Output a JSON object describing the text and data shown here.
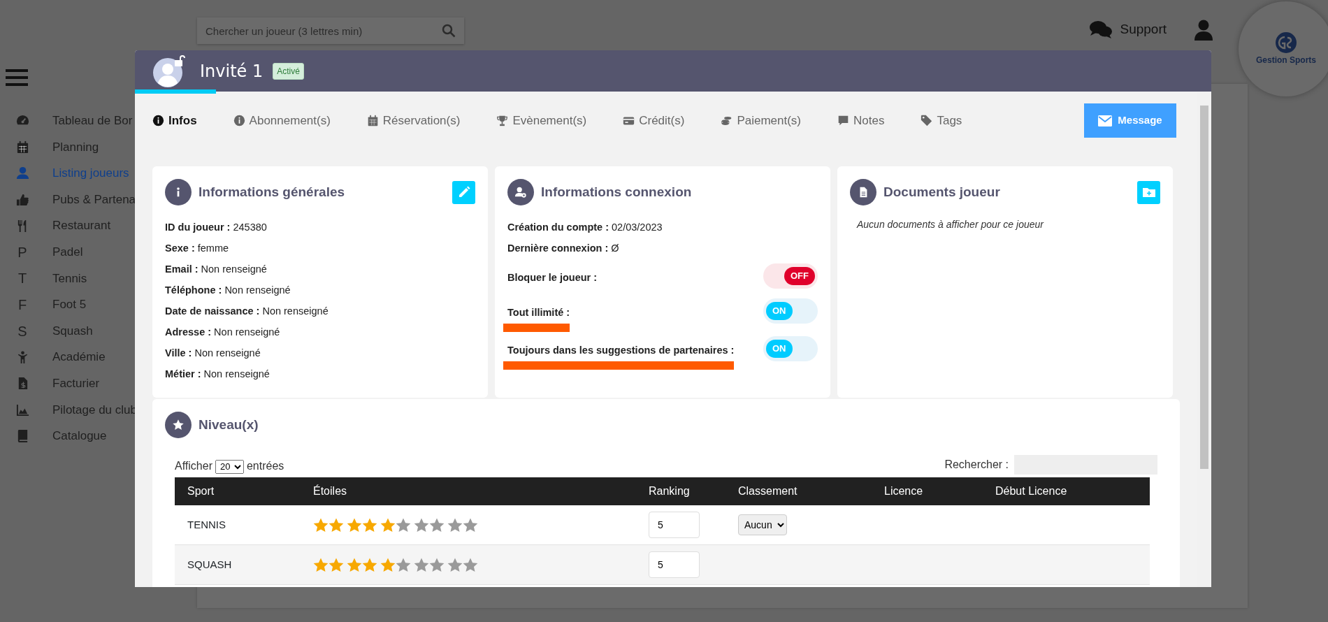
{
  "header": {
    "search": {
      "placeholder": "Chercher un joueur (3 lettres min)"
    },
    "support": "Support",
    "logo": "Gestion Sports"
  },
  "sidebar": {
    "items": [
      {
        "label": "Tableau de Bor",
        "selected": false
      },
      {
        "label": "Planning",
        "selected": false
      },
      {
        "label": "Listing joueurs",
        "selected": true
      },
      {
        "label": "Pubs & Partena",
        "selected": false
      },
      {
        "label": "Restaurant",
        "selected": false
      },
      {
        "letter": "P",
        "label": "Padel",
        "selected": false
      },
      {
        "letter": "T",
        "label": "Tennis",
        "selected": false
      },
      {
        "letter": "F",
        "label": "Foot 5",
        "selected": false
      },
      {
        "letter": "S",
        "label": "Squash",
        "selected": false
      },
      {
        "label": "Académie",
        "selected": false
      },
      {
        "label": "Facturier",
        "selected": false
      },
      {
        "label": "Pilotage du club",
        "selected": false
      },
      {
        "label": "Catalogue",
        "selected": false
      }
    ]
  },
  "modal": {
    "title": "Invité 1",
    "badge": "Activé",
    "tabs": [
      {
        "label": "Infos",
        "selected": true
      },
      {
        "label": "Abonnement(s)",
        "selected": false
      },
      {
        "label": "Réservation(s)",
        "selected": false
      },
      {
        "label": "Evènement(s)",
        "selected": false
      },
      {
        "label": "Crédit(s)",
        "selected": false
      },
      {
        "label": "Paiement(s)",
        "selected": false
      },
      {
        "label": "Notes",
        "selected": false
      },
      {
        "label": "Tags",
        "selected": false
      }
    ],
    "message_button": "Message",
    "general": {
      "title": "Informations générales",
      "fields": [
        {
          "label": "ID du joueur :",
          "value": "245380"
        },
        {
          "label": "Sexe :",
          "value": "femme"
        },
        {
          "label": "Email :",
          "value": "Non renseigné"
        },
        {
          "label": "Téléphone :",
          "value": "Non renseigné"
        },
        {
          "label": "Date de naissance :",
          "value": "Non renseigné"
        },
        {
          "label": "Adresse :",
          "value": "Non renseigné"
        },
        {
          "label": "Ville :",
          "value": "Non renseigné"
        },
        {
          "label": "Métier :",
          "value": "Non renseigné"
        }
      ]
    },
    "connexion": {
      "title": "Informations connexion",
      "rows": [
        {
          "kind": "text",
          "label": "Création du compte :",
          "value": "02/03/2023"
        },
        {
          "kind": "text",
          "label": "Dernière connexion :",
          "value": "Ø"
        },
        {
          "kind": "toggle",
          "label": "Bloquer le joueur :",
          "on": false,
          "state_text": "OFF",
          "underlined": false
        },
        {
          "kind": "toggle",
          "label": "Tout illimité :",
          "on": true,
          "state_text": "ON",
          "underlined": true
        },
        {
          "kind": "toggle",
          "label": "Toujours dans les suggestions de partenaires :",
          "on": true,
          "state_text": "ON",
          "underlined": true
        }
      ]
    },
    "documents": {
      "title": "Documents joueur",
      "empty_text": "Aucun documents à afficher pour ce joueur"
    },
    "levels": {
      "title": "Niveau(x)",
      "show_label": "Afficher",
      "page_size": "20",
      "entries_label": "entrées",
      "search_label": "Rechercher :",
      "columns": [
        "Sport",
        "Étoiles",
        "Ranking",
        "Classement",
        "Licence",
        "Début Licence"
      ],
      "rows": [
        {
          "sport": "TENNIS",
          "stars": 5,
          "ranking": "5",
          "classement": "Aucun"
        },
        {
          "sport": "SQUASH",
          "stars": 5,
          "ranking": "5"
        }
      ]
    }
  }
}
